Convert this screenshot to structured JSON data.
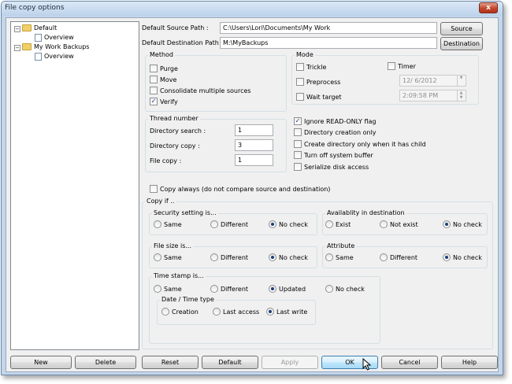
{
  "window": {
    "title": "File copy options",
    "close_label": "x"
  },
  "tree": {
    "items": [
      {
        "label": "Default",
        "type": "folder",
        "expander": "−"
      },
      {
        "label": "Overview",
        "type": "doc"
      },
      {
        "label": "My Work Backups",
        "type": "folder",
        "expander": "−"
      },
      {
        "label": "Overview",
        "type": "doc"
      }
    ]
  },
  "paths": {
    "source_label": "Default Source Path :",
    "source_value": "C:\\Users\\Lori\\Documents\\My Work",
    "source_button": "Source",
    "dest_label": "Default Destination Path :",
    "dest_value": "M:\\MyBackups",
    "dest_button": "Destination"
  },
  "method": {
    "title": "Method",
    "purge": "Purge",
    "move": "Move",
    "consolidate": "Consolidate multiple sources",
    "verify": "Verify",
    "verify_checked": true
  },
  "mode": {
    "title": "Mode",
    "trickle": "Trickle",
    "timer": "Timer",
    "preprocess": "Preprocess",
    "wait_target": "Wait target",
    "date_value": "12/ 6/2012",
    "time_value": "2:09:58 PM"
  },
  "thread": {
    "title": "Thread number",
    "dir_search_label": "Directory search :",
    "dir_search_value": "1",
    "dir_copy_label": "Directory copy :",
    "dir_copy_value": "3",
    "file_copy_label": "File copy :",
    "file_copy_value": "1"
  },
  "flags": {
    "ignore_readonly": "Ignore READ-ONLY flag",
    "ignore_readonly_checked": true,
    "dir_creation_only": "Directory creation only",
    "create_dir_child": "Create directory only when it has child",
    "turn_off_buffer": "Turn off system buffer",
    "serialize": "Serialize disk access"
  },
  "copy_always": "Copy always (do not compare source and destination)",
  "copy_if": {
    "title": "Copy if ..",
    "security": {
      "title": "Security setting is...",
      "opt1": "Same",
      "opt2": "Different",
      "opt3": "No check",
      "selected": 3
    },
    "availability": {
      "title": "Availablity in destination",
      "opt1": "Exist",
      "opt2": "Not exist",
      "opt3": "No check",
      "selected": 3
    },
    "file_size": {
      "title": "File size is...",
      "opt1": "Same",
      "opt2": "Different",
      "opt3": "No check",
      "selected": 3
    },
    "attribute": {
      "title": "Attribute",
      "opt1": "Same",
      "opt2": "Different",
      "opt3": "No check",
      "selected": 3
    },
    "time_stamp": {
      "title": "Time stamp is...",
      "opt1": "Same",
      "opt2": "Different",
      "opt3": "Updated",
      "opt4": "No check",
      "selected": 3
    },
    "date_time_type": {
      "title": "Date / Time type",
      "opt1": "Creation",
      "opt2": "Last access",
      "opt3": "Last write",
      "selected": 3
    }
  },
  "buttons": {
    "new": "New",
    "delete": "Delete",
    "reset": "Reset",
    "default": "Default",
    "apply": "Apply",
    "ok": "OK",
    "cancel": "Cancel",
    "help": "Help"
  }
}
